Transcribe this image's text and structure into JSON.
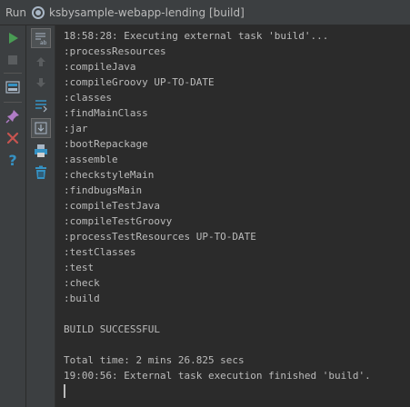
{
  "titlebar": {
    "run_label": "Run",
    "title": "ksbysample-webapp-lending [build]"
  },
  "toolbar": {
    "icons": [
      "run-icon",
      "stop-icon",
      "layout-icon",
      "pin-icon",
      "close-icon",
      "help-icon",
      "soft-wrap-icon",
      "scroll-up-icon",
      "scroll-down-icon",
      "sort-icon",
      "scroll-to-end-icon",
      "print-icon",
      "trash-icon"
    ]
  },
  "console": {
    "lines": [
      "18:58:28: Executing external task 'build'...",
      ":processResources",
      ":compileJava",
      ":compileGroovy UP-TO-DATE",
      ":classes",
      ":findMainClass",
      ":jar",
      ":bootRepackage",
      ":assemble",
      ":checkstyleMain",
      ":findbugsMain",
      ":compileTestJava",
      ":compileTestGroovy",
      ":processTestResources UP-TO-DATE",
      ":testClasses",
      ":test",
      ":check",
      ":build",
      "",
      "BUILD SUCCESSFUL",
      "",
      "Total time: 2 mins 26.825 secs",
      "19:00:56: External task execution finished 'build'."
    ]
  },
  "colors": {
    "background": "#2b2b2b",
    "panel": "#3c3f41",
    "text": "#bbbbbb",
    "run_green": "#499c54",
    "close_red": "#c75450",
    "help_blue": "#3592c4"
  }
}
